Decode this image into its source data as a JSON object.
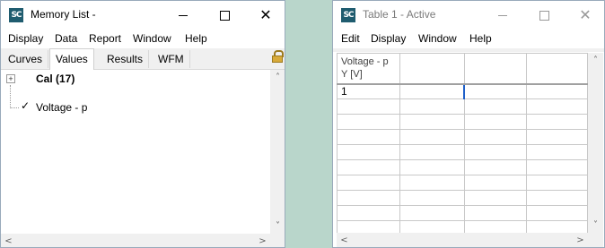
{
  "left_window": {
    "app_icon_text": "SC",
    "title": "Memory List -",
    "controls": {
      "close": "✕"
    },
    "menu": [
      "Display",
      "Data",
      "Report",
      "Window",
      "Help"
    ],
    "tabs": [
      "Curves",
      "Values",
      "Results",
      "WFM"
    ],
    "active_tab": "Values",
    "tree": {
      "root": {
        "label": "Cal (17)",
        "expander": "+"
      },
      "child": {
        "label": "Voltage - p",
        "check": "✓"
      }
    },
    "scroll_arrows": {
      "up": "˄",
      "down": "˅",
      "left": "<",
      "right": ">"
    }
  },
  "right_window": {
    "app_icon_text": "SC",
    "title": "Table 1 - Active",
    "controls": {
      "close": "✕"
    },
    "menu": [
      "Edit",
      "Display",
      "Window",
      "Help"
    ],
    "table": {
      "header_line1": "Voltage - p",
      "header_line2": "Y [V]",
      "first_value": "1"
    },
    "scroll_arrows": {
      "up": "˄",
      "down": "˅",
      "left": "<",
      "right": ">"
    }
  }
}
